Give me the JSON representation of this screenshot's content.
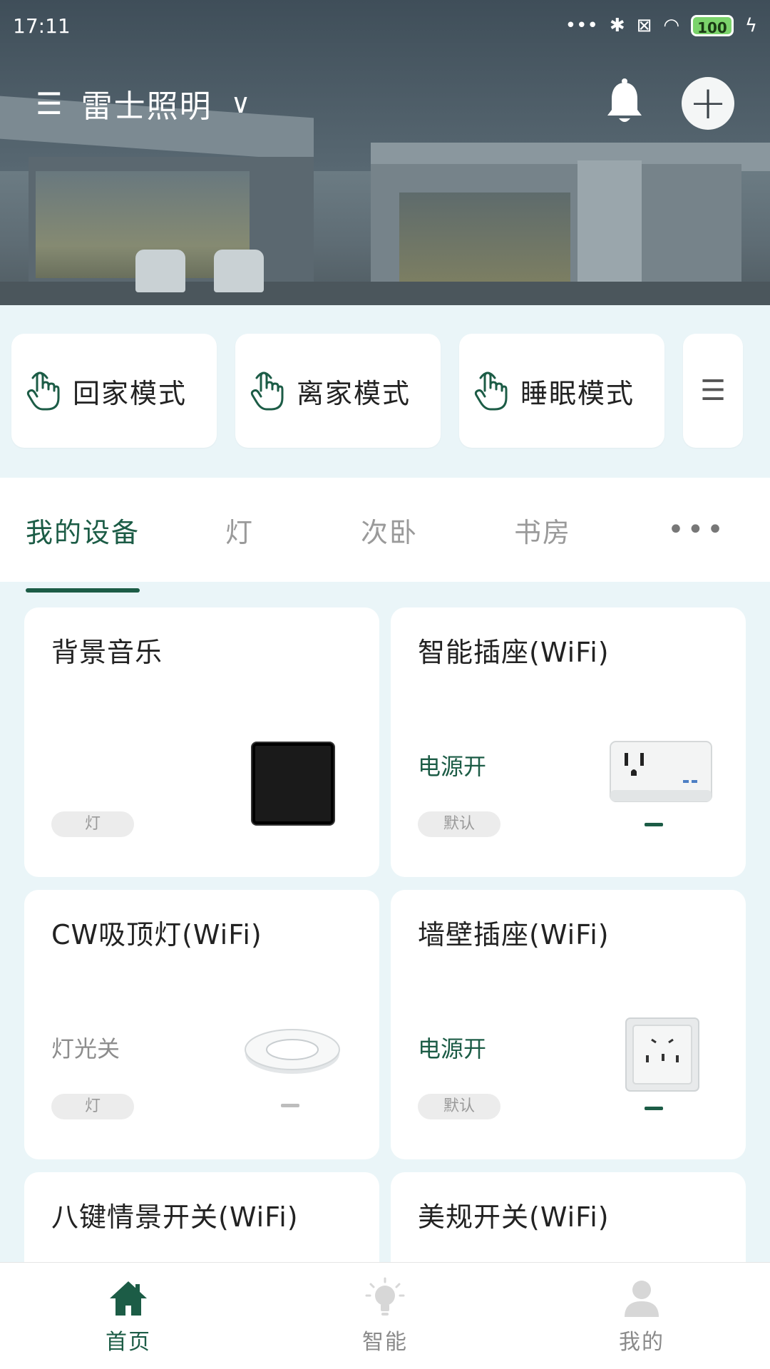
{
  "status_bar": {
    "time": "17:11",
    "dots": "•••",
    "battery": "100"
  },
  "header": {
    "home_name": "雷士照明",
    "menu_glyph": "☰",
    "chevron_glyph": "∨",
    "add_glyph": "+"
  },
  "scenes": [
    {
      "label": "回家模式"
    },
    {
      "label": "离家模式"
    },
    {
      "label": "睡眠模式"
    }
  ],
  "scenes_more_glyph": "☰",
  "tabs": [
    {
      "label": "我的设备",
      "active": true
    },
    {
      "label": "灯"
    },
    {
      "label": "次卧"
    },
    {
      "label": "书房"
    }
  ],
  "tabs_more": "•••",
  "devices": [
    {
      "name": "背景音乐",
      "status": "",
      "tag": "灯",
      "icon": "black-panel"
    },
    {
      "name": "智能插座(WiFi)",
      "status": "电源开",
      "tag": "默认",
      "icon": "us-socket"
    },
    {
      "name": "CW吸顶灯(WiFi)",
      "status": "灯光关",
      "tag": "灯",
      "icon": "ceiling-light"
    },
    {
      "name": "墙壁插座(WiFi)",
      "status": "电源开",
      "tag": "默认",
      "icon": "wall-socket"
    },
    {
      "name": "八键情景开关(WiFi)"
    },
    {
      "name": "美规开关(WiFi)"
    }
  ],
  "bottom_nav": [
    {
      "label": "首页",
      "icon": "home-icon",
      "active": true
    },
    {
      "label": "智能",
      "icon": "bulb-icon"
    },
    {
      "label": "我的",
      "icon": "person-icon"
    }
  ],
  "colors": {
    "accent": "#1c5c46",
    "background": "#eaf5f8",
    "inactive": "#9a9a9a"
  }
}
